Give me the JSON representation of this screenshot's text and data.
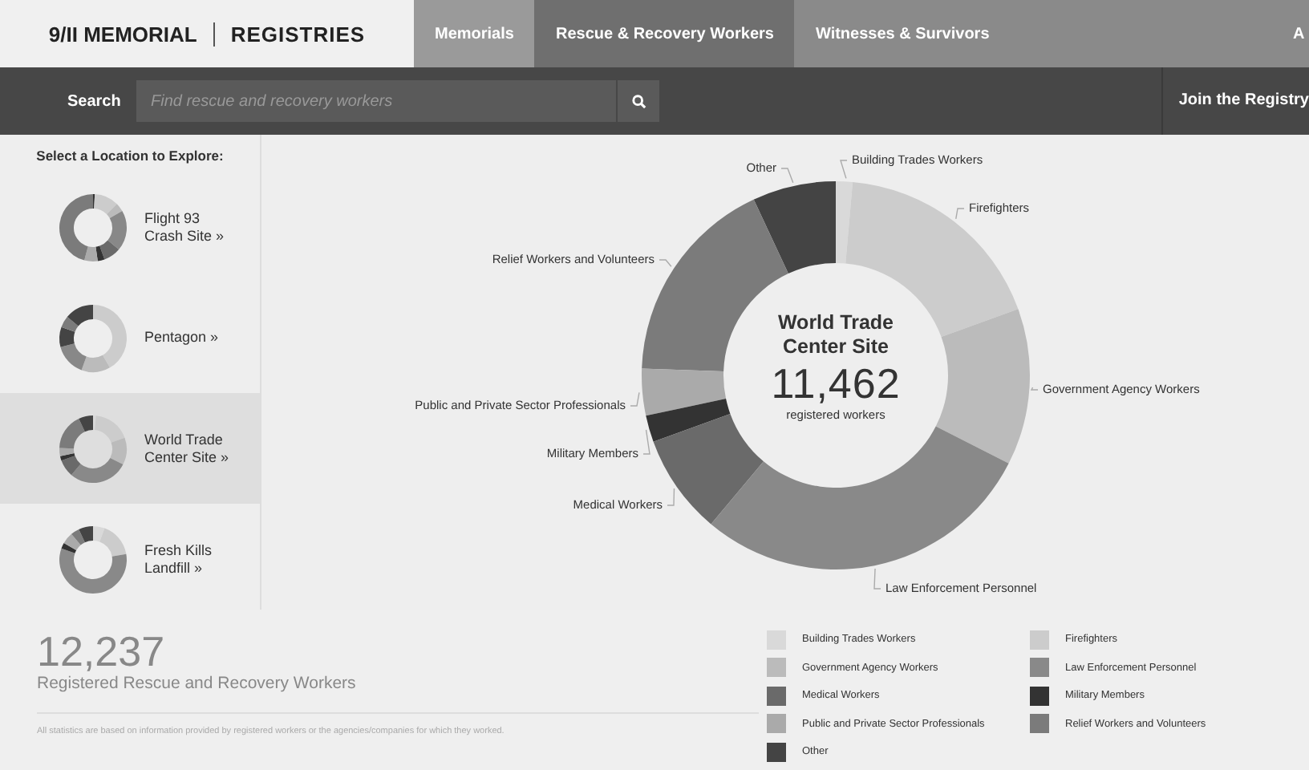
{
  "header": {
    "logo_left": "9/II MEMORIAL",
    "logo_right": "REGISTRIES"
  },
  "nav_tabs": [
    {
      "label": "Memorials",
      "selected": false
    },
    {
      "label": "Rescue & Recovery Workers",
      "selected": true
    },
    {
      "label": "Witnesses & Survivors",
      "selected": false
    },
    {
      "label": "A",
      "selected": false
    }
  ],
  "search": {
    "label": "Search",
    "placeholder": "Find rescue and recovery workers"
  },
  "join_link": "Join the Registry",
  "sidebar": {
    "heading": "Select a Location to Explore:",
    "items": [
      {
        "label": "Flight 93 Crash Site »",
        "selected": false
      },
      {
        "label": "Pentagon »",
        "selected": false
      },
      {
        "label": "World Trade Center Site »",
        "selected": true
      },
      {
        "label": "Fresh Kills Landfill »",
        "selected": false
      }
    ]
  },
  "chart": {
    "title": "World Trade Center Site",
    "count": "11,462",
    "caption": "registered workers",
    "slices": [
      {
        "label": "Other",
        "color": "#444444"
      },
      {
        "label": "Building Trades Workers",
        "color": "#d9d9d9"
      },
      {
        "label": "Firefighters",
        "color": "#cccccc"
      },
      {
        "label": "Relief Workers and Volunteers",
        "color": "#7b7b7b"
      },
      {
        "label": "Government Agency Workers",
        "color": "#bbbbbb"
      },
      {
        "label": "Public and Private Sector Professionals",
        "color": "#aaaaaa"
      },
      {
        "label": "Military Members",
        "color": "#333333"
      },
      {
        "label": "Medical Workers",
        "color": "#6a6a6a"
      },
      {
        "label": "Law Enforcement Personnel",
        "color": "#898989"
      }
    ]
  },
  "summary": {
    "total": "12,237",
    "caption": "Registered Rescue and Recovery Workers",
    "note": "All statistics are based on information provided by registered workers or the agencies/companies for which they worked."
  },
  "legend": [
    {
      "label": "Building Trades Workers",
      "color": "#d9d9d9"
    },
    {
      "label": "Firefighters",
      "color": "#cccccc"
    },
    {
      "label": "Government Agency Workers",
      "color": "#bbbbbb"
    },
    {
      "label": "Law Enforcement Personnel",
      "color": "#898989"
    },
    {
      "label": "Medical Workers",
      "color": "#6a6a6a"
    },
    {
      "label": "Military Members",
      "color": "#333333"
    },
    {
      "label": "Public and Private Sector Professionals",
      "color": "#aaaaaa"
    },
    {
      "label": "Relief Workers and Volunteers",
      "color": "#7b7b7b"
    },
    {
      "label": "Other",
      "color": "#444444"
    }
  ]
}
